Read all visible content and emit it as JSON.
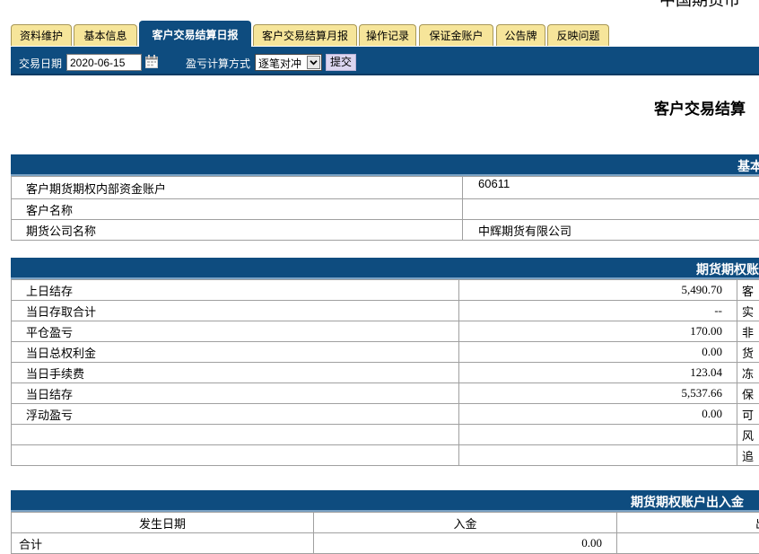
{
  "header": {
    "title": "中国期货市"
  },
  "tabs": [
    {
      "label": "资料维护",
      "active": false
    },
    {
      "label": "基本信息",
      "active": false
    },
    {
      "label": "客户交易结算日报",
      "active": true
    },
    {
      "label": "客户交易结算月报",
      "active": false
    },
    {
      "label": "操作记录",
      "active": false
    },
    {
      "label": "保证金账户",
      "active": false
    },
    {
      "label": "公告牌",
      "active": false
    },
    {
      "label": "反映问题",
      "active": false
    }
  ],
  "toolbar": {
    "date_label": "交易日期",
    "date_value": "2020-06-15",
    "pnl_label": "盈亏计算方式",
    "pnl_method": "逐笔对冲",
    "submit_label": "提交"
  },
  "report": {
    "title": "客户交易结算"
  },
  "basic": {
    "header": "基本",
    "rows": [
      {
        "label": "客户期货期权内部资金账户",
        "value": "60611"
      },
      {
        "label": "客户名称",
        "value": ""
      },
      {
        "label": "期货公司名称",
        "value": "中辉期货有限公司"
      }
    ]
  },
  "account": {
    "header": "期货期权账",
    "rows": [
      {
        "label": "上日结存",
        "value": "5,490.70",
        "right": "客"
      },
      {
        "label": "当日存取合计",
        "value": "--",
        "right": "实"
      },
      {
        "label": "平仓盈亏",
        "value": "170.00",
        "right": "非"
      },
      {
        "label": "当日总权利金",
        "value": "0.00",
        "right": "货"
      },
      {
        "label": "当日手续费",
        "value": "123.04",
        "right": "冻"
      },
      {
        "label": "当日结存",
        "value": "5,537.66",
        "right": "保"
      },
      {
        "label": "浮动盈亏",
        "value": "0.00",
        "right": "可"
      },
      {
        "label": "",
        "value": "",
        "right": "风"
      },
      {
        "label": "",
        "value": "",
        "right": "追"
      }
    ]
  },
  "deposits": {
    "header": "期货期权账户出入金",
    "columns": [
      "发生日期",
      "入金",
      "出"
    ],
    "total_label": "合计",
    "total_in": "0.00"
  },
  "colors": {
    "primary": "#0e4c7f",
    "tab_bg": "#f6e59a",
    "border": "#a0a0a0"
  }
}
